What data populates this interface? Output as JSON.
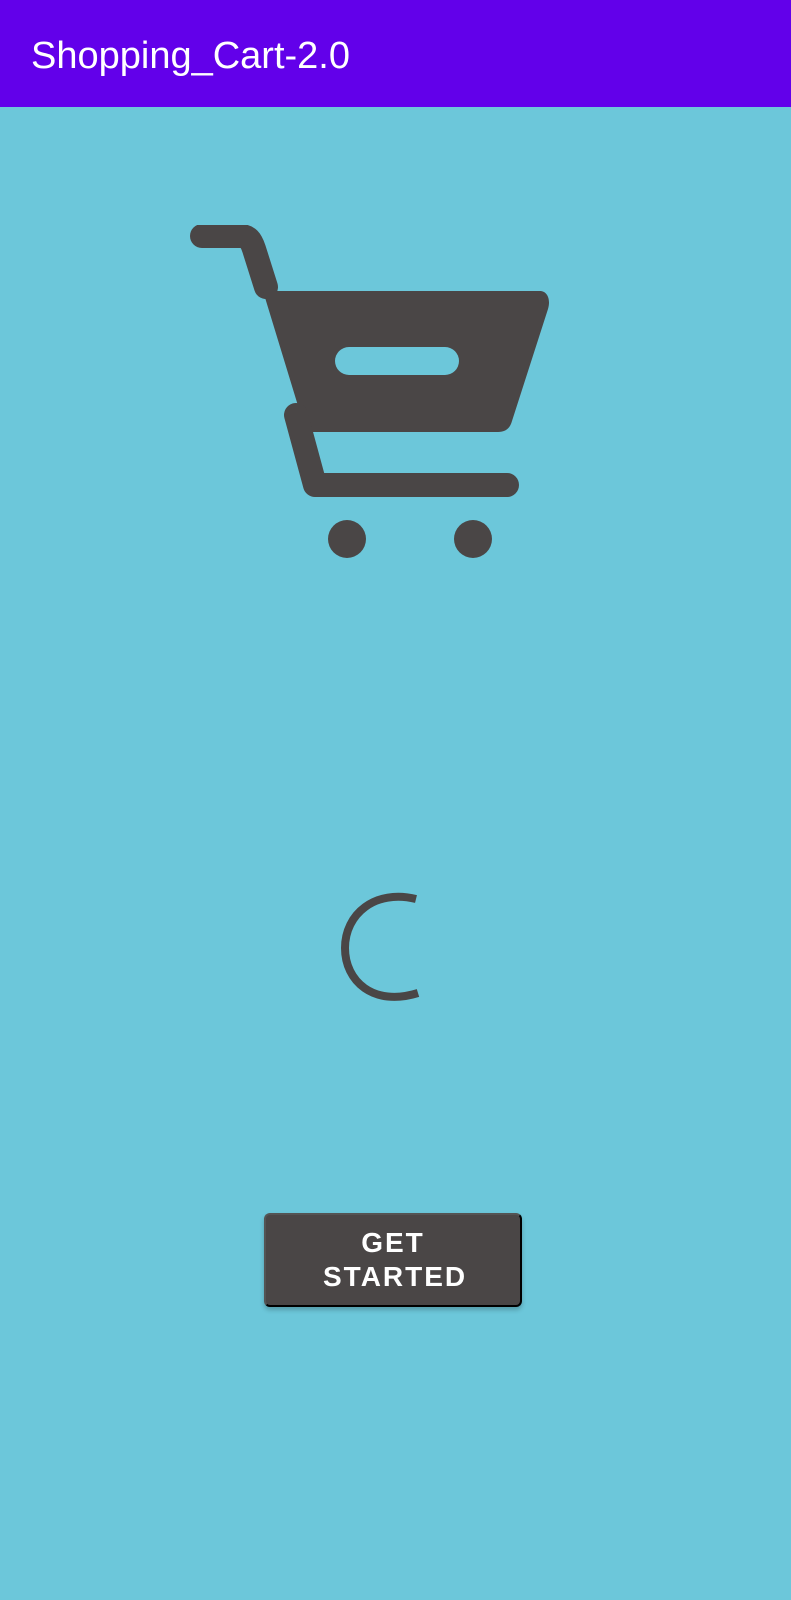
{
  "app": {
    "title": "Shopping_Cart-2.0"
  },
  "icons": {
    "cart": "shopping-cart-icon",
    "loading": "loading-spinner"
  },
  "actions": {
    "get_started_label": "GET STARTED"
  },
  "colors": {
    "app_bar": "#6200ea",
    "background": "#6cc7da",
    "icon": "#4a4646",
    "button": "#4a4646",
    "button_text": "#ffffff"
  }
}
